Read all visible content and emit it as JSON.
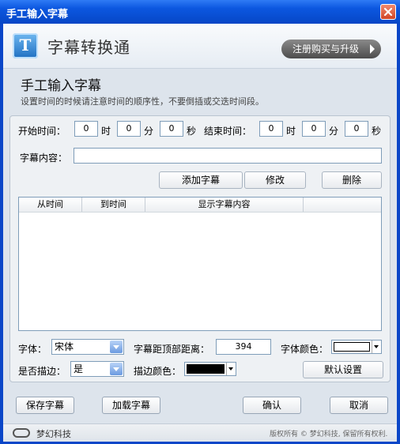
{
  "window": {
    "title": "手工输入字幕"
  },
  "banner": {
    "app_name": "字幕转换通",
    "upgrade_label": "注册购买与升级",
    "logo_letter": "T"
  },
  "heading": "手工输入字幕",
  "subheading": "设置时间的时候请注意时间的顺序性，不要倒插或交迭时间段。",
  "time": {
    "start_label": "开始时间：",
    "end_label": "结束时间：",
    "hour_unit": "时",
    "minute_unit": "分",
    "second_unit": "秒",
    "start_h": "0",
    "start_m": "0",
    "start_s": "0",
    "end_h": "0",
    "end_m": "0",
    "end_s": "0"
  },
  "content": {
    "label": "字幕内容：",
    "value": ""
  },
  "actions": {
    "add": "添加字幕",
    "modify": "修改",
    "delete": "删除"
  },
  "table": {
    "columns": [
      "从时间",
      "到时间",
      "显示字幕内容"
    ],
    "rows": []
  },
  "settings": {
    "font_label": "字体：",
    "font_value": "宋体",
    "top_distance_label": "字幕距顶部距离：",
    "top_distance_value": "394",
    "font_color_label": "字体颜色：",
    "font_color": "#ffffff",
    "outline_label": "是否描边：",
    "outline_value": "是",
    "outline_color_label": "描边颜色：",
    "outline_color": "#000000",
    "default_label": "默认设置"
  },
  "bottom": {
    "save": "保存字幕",
    "load": "加载字幕",
    "ok": "确认",
    "cancel": "取消"
  },
  "footer": {
    "company": "梦幻科技",
    "copyright": "版权所有 © 梦幻科技, 保留所有权利."
  }
}
